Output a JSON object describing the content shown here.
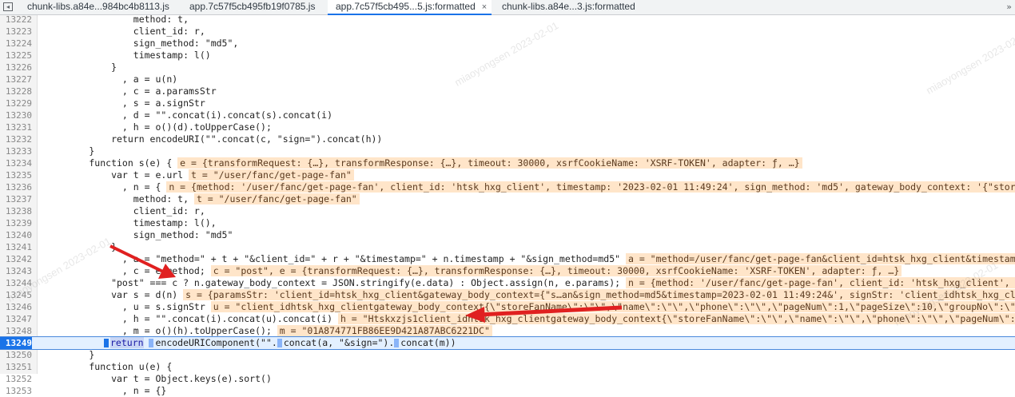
{
  "tabs": [
    {
      "label": "chunk-libs.a84e...984bc4b8113.js",
      "active": false
    },
    {
      "label": "app.7c57f5cb495fb19f0785.js",
      "active": false
    },
    {
      "label": "app.7c57f5cb495...5.js:formatted",
      "active": true,
      "close": "×"
    },
    {
      "label": "chunk-libs.a84e...3.js:formatted",
      "active": false
    }
  ],
  "nav_icon": "panel-toggle-icon",
  "more_icon": "chevron-right-icon",
  "more_glyph": "»",
  "watermark": "miaoyongsen 2023-02-01",
  "lines": [
    {
      "n": "13222",
      "code": "                method: t,"
    },
    {
      "n": "13223",
      "code": "                client_id: r,"
    },
    {
      "n": "13224",
      "code": "                sign_method: \"md5\","
    },
    {
      "n": "13225",
      "code": "                timestamp: l()"
    },
    {
      "n": "13226",
      "code": "            }"
    },
    {
      "n": "13227",
      "code": "              , a = u(n)"
    },
    {
      "n": "13228",
      "code": "              , c = a.paramsStr"
    },
    {
      "n": "13229",
      "code": "              , s = a.signStr"
    },
    {
      "n": "13230",
      "code": "              , d = \"\".concat(i).concat(s).concat(i)"
    },
    {
      "n": "13231",
      "code": "              , h = o()(d).toUpperCase();"
    },
    {
      "n": "13232",
      "code": "            return encodeURI(\"\".concat(c, \"sign=\").concat(h))"
    },
    {
      "n": "13233",
      "code": "        }"
    },
    {
      "n": "13234",
      "code": "        function s(e) { ",
      "val": "e = {transformRequest: {…}, transformResponse: {…}, timeout: 30000, xsrfCookieName: 'XSRF-TOKEN', adapter: ƒ, …}"
    },
    {
      "n": "13235",
      "code": "            var t = e.url ",
      "val": "t = \"/user/fanc/get-page-fan\""
    },
    {
      "n": "13236",
      "code": "              , n = { ",
      "val": "n = {method: '/user/fanc/get-page-fan', client_id: 'htsk_hxg_client', timestamp: '2023-02-01 11:49:24', sign_method: 'md5', gateway_body_context: '{\"storeFanNam"
    },
    {
      "n": "13237",
      "code": "                method: t, ",
      "val": "t = \"/user/fanc/get-page-fan\""
    },
    {
      "n": "13238",
      "code": "                client_id: r,"
    },
    {
      "n": "13239",
      "code": "                timestamp: l(),"
    },
    {
      "n": "13240",
      "code": "                sign_method: \"md5\""
    },
    {
      "n": "13241",
      "code": "            }"
    },
    {
      "n": "13242",
      "code": "              , a = \"method=\" + t + \"&client_id=\" + r + \"&timestamp=\" + n.timestamp + \"&sign_method=md5\" ",
      "val": "a = \"method=/user/fanc/get-page-fan&client_id=htsk_hxg_client&timestamp=2023-"
    },
    {
      "n": "13243",
      "code": "              , c = e.method; ",
      "val": "c = \"post\", e = {transformRequest: {…}, transformResponse: {…}, timeout: 30000, xsrfCookieName: 'XSRF-TOKEN', adapter: ƒ, …}"
    },
    {
      "n": "13244",
      "code": "            \"post\" === c ? n.gateway_body_context = JSON.stringify(e.data) : Object.assign(n, e.params); ",
      "val": "n = {method: '/user/fanc/get-page-fan', client_id: 'htsk_hxg_client', timesta"
    },
    {
      "n": "13245",
      "code": "            var s = d(n) ",
      "val": "s = {paramsStr: 'client_id=htsk_hxg_client&gateway_body_context={\"s…an&sign_method=md5&timestamp=2023-02-01 11:49:24&', signStr: 'client_idhtsk_hxg_clientga"
    },
    {
      "n": "13246",
      "code": "              , u = s.signStr ",
      "val": "u = \"client_idhtsk_hxg_clientgateway_body_context{\\\"storeFanName\\\":\\\"\\\",\\\"name\\\":\\\"\\\",\\\"phone\\\":\\\"\\\",\\\"pageNum\\\":1,\\\"pageSize\\\":10,\\\"groupNo\\\":\\\"\\\"}meth"
    },
    {
      "n": "13247",
      "code": "              , h = \"\".concat(i).concat(u).concat(i) ",
      "val": "h = \"Htskxzjs1client_idhtsk_hxg_clientgateway_body_context{\\\"storeFanName\\\":\\\"\\\",\\\"name\\\":\\\"\\\",\\\"phone\\\":\\\"\\\",\\\"pageNum\\\":1,\\\"pag"
    },
    {
      "n": "13248",
      "code": "              , m = o()(h).toUpperCase(); ",
      "val": "m = \"01A874771FB86EE9D421A87ABC6221DC\""
    },
    {
      "n": "13249",
      "code": "return ",
      "code2": "encodeURIComponent(\"\".",
      "code3": "concat(a, \"&sign=\").",
      "code4": "concat(m))"
    },
    {
      "n": "13250",
      "code": "        }"
    },
    {
      "n": "13251",
      "code": "        function u(e) {"
    },
    {
      "n": "13252",
      "code": "            var t = Object.keys(e).sort()"
    },
    {
      "n": "13253",
      "code": "              , n = {}"
    }
  ]
}
